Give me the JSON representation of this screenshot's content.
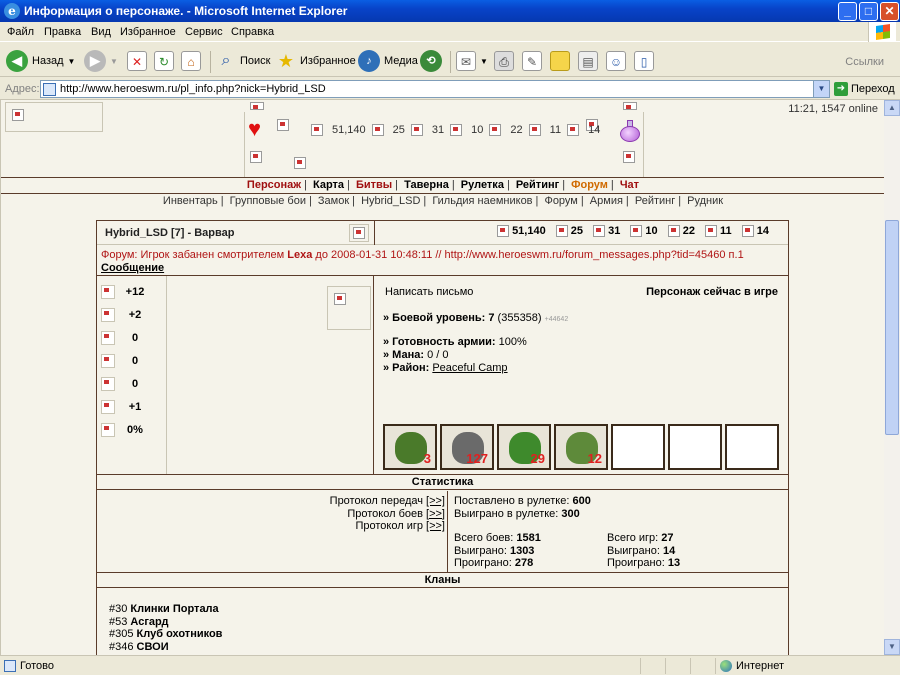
{
  "window": {
    "title": "Информация о персонаже. - Microsoft Internet Explorer",
    "ie_glyph": "e",
    "minimize_glyph": "_",
    "maximize_glyph": "□",
    "close_glyph": "✕"
  },
  "menu": [
    "Файл",
    "Правка",
    "Вид",
    "Избранное",
    "Сервис",
    "Справка"
  ],
  "toolbar": {
    "back": "Назад",
    "search": "Поиск",
    "favorites": "Избранное",
    "media": "Медиа",
    "links": "Ссылки"
  },
  "address": {
    "label": "Адрес:",
    "url": "http://www.heroeswm.ru/pl_info.php?nick=Hybrid_LSD",
    "go": "Переход"
  },
  "header": {
    "time_online": "11:21, 1547 online",
    "resources": [
      "51,140",
      "25",
      "31",
      "10",
      "22",
      "11",
      "14"
    ]
  },
  "nav_primary": [
    {
      "label": "Персонаж",
      "color": "red"
    },
    {
      "label": "Карта",
      "color": "black"
    },
    {
      "label": "Битвы",
      "color": "red"
    },
    {
      "label": "Таверна",
      "color": "black"
    },
    {
      "label": "Рулетка",
      "color": "black"
    },
    {
      "label": "Рейтинг",
      "color": "black"
    },
    {
      "label": "Форум",
      "color": "orange"
    },
    {
      "label": "Чат",
      "color": "red"
    }
  ],
  "nav_secondary": [
    "Инвентарь",
    "Групповые бои",
    "Замок",
    "Hybrid_LSD",
    "Гильдия наемников",
    "Форум",
    "Армия",
    "Рейтинг",
    "Рудник"
  ],
  "character": {
    "name_line": "Hybrid_LSD  [7] - Варвар",
    "resources": [
      "51,140",
      "25",
      "31",
      "10",
      "22",
      "11",
      "14"
    ],
    "ban_text_1": "Форум: Игрок забанен смотрителем ",
    "ban_moderator": "Lexa",
    "ban_text_2": " до 2008-01-31 10:48:11 // http://www.heroeswm.ru/forum_messages.php?tid=45460 п.1 ",
    "ban_link": "Сообщение",
    "stats": [
      "+12",
      "+2",
      "0",
      "0",
      "0",
      "+1",
      "0%"
    ],
    "write_letter": "Написать письмо",
    "online_status": "Персонаж сейчас в игре",
    "level_label": "» Боевой уровень:",
    "level_value": "7",
    "level_exp": "(355358)",
    "level_exp_small": "+44642",
    "army_ready_label": "» Готовность армии:",
    "army_ready_value": "100%",
    "mana_label": "» Мана:",
    "mana_value": "0 / 0",
    "district_label": "» Район:",
    "district_value": "Peaceful Camp",
    "army": [
      {
        "count": "3",
        "color": "#4a7a2a"
      },
      {
        "count": "127",
        "color": "#6a6a6a"
      },
      {
        "count": "29",
        "color": "#3e8a2c"
      },
      {
        "count": "12",
        "color": "#5e8a3a"
      },
      {
        "count": ""
      },
      {
        "count": ""
      },
      {
        "count": ""
      }
    ]
  },
  "statistics": {
    "title": "Статистика",
    "protocols": [
      "Протокол передач",
      "Протокол боев",
      "Протокол игр"
    ],
    "bracket_link": "[>>]",
    "roulette_bet_label": "Поставлено в рулетке:",
    "roulette_bet_value": "600",
    "roulette_won_label": "Выиграно в рулетке:",
    "roulette_won_value": "300",
    "battles_total_label": "Всего боев:",
    "battles_total_value": "1581",
    "battles_won_label": "Выиграно:",
    "battles_won_value": "1303",
    "battles_lost_label": "Проиграно:",
    "battles_lost_value": "278",
    "games_total_label": "Всего игр:",
    "games_total_value": "27",
    "games_won_label": "Выиграно:",
    "games_won_value": "14",
    "games_lost_label": "Проиграно:",
    "games_lost_value": "13"
  },
  "clans": {
    "title": "Кланы",
    "items": [
      {
        "id": "#30",
        "name": "Клинки Портала"
      },
      {
        "id": "#53",
        "name": "Асгард"
      },
      {
        "id": "#305",
        "name": "Клуб охотников"
      },
      {
        "id": "#346",
        "name": "СВОИ"
      }
    ]
  },
  "statusbar": {
    "text": "Готово",
    "zone": "Интернет"
  }
}
